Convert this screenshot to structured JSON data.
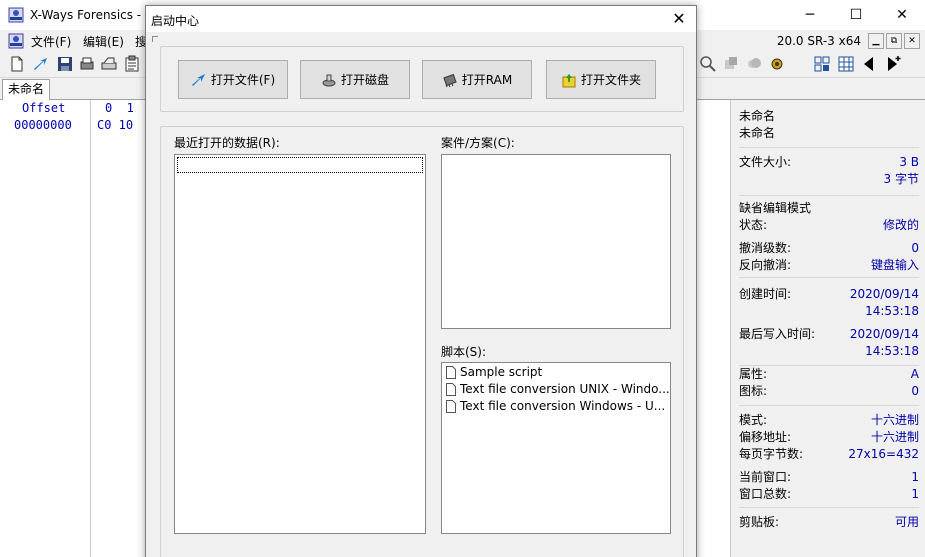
{
  "app": {
    "title": "X-Ways Forensics - ",
    "version": "20.0 SR-3 x64",
    "window_controls": {
      "minimize": "─",
      "maximize": "☐",
      "close": "✕"
    },
    "mdi_controls": {
      "minimize": "▁",
      "restore": "⧉",
      "close": "✕"
    }
  },
  "menu": {
    "items": [
      "文件(F)",
      "编辑(E)",
      "搜"
    ]
  },
  "tab": {
    "label": "未命名"
  },
  "hex": {
    "header_offset": "Offset",
    "header_cols": "0  1",
    "row_offset": "00000000",
    "row_bytes": "C0 10"
  },
  "info": {
    "name1": "未命名",
    "name2": "未命名",
    "file_size_label": "文件大小:",
    "file_size_bytes": "3 B",
    "file_size_chars": "3 字节",
    "edit_mode_label": "缺省编辑模式",
    "state_label": "状态:",
    "state_value": "修改的",
    "undo_label": "撤消级数:",
    "undo_value": "0",
    "reverse_undo_label": "反向撤消:",
    "reverse_undo_value": "键盘输入",
    "created_label": "创建时间:",
    "created_date": "2020/09/14",
    "created_time": "14:53:18",
    "written_label": "最后写入时间:",
    "written_date": "2020/09/14",
    "written_time": "14:53:18",
    "attr_label": "属性:",
    "attr_value": "A",
    "icon_label": "图标:",
    "icon_value": "0",
    "mode_label": "模式:",
    "mode_value": "十六进制",
    "offset_label": "偏移地址:",
    "offset_value": "十六进制",
    "bytes_per_page_label": "每页字节数:",
    "bytes_per_page_value": "27x16=432",
    "current_window_label": "当前窗口:",
    "current_window_value": "1",
    "window_total_label": "窗口总数:",
    "window_total_value": "1",
    "clipboard_label": "剪贴板:",
    "clipboard_value": "可用"
  },
  "dialog": {
    "title": "启动中心",
    "close": "✕",
    "buttons": {
      "open_file": "打开文件(F)",
      "open_disk": "打开磁盘",
      "open_ram": "打开RAM",
      "open_folder": "打开文件夹"
    },
    "recent_label": "最近打开的数据(R):",
    "cases_label": "案件/方案(C):",
    "scripts_label": "脚本(S):",
    "scripts": [
      "Sample script",
      "Text file conversion UNIX - Windo...",
      "Text file conversion Windows - U..."
    ]
  }
}
